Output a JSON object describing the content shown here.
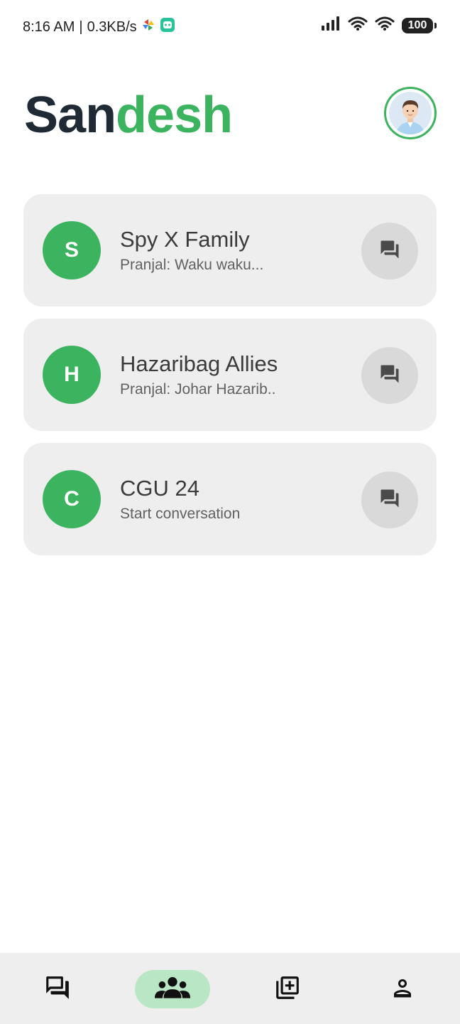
{
  "status_bar": {
    "time": "8:16 AM",
    "separator": "|",
    "speed": "0.3KB/s",
    "battery": "100",
    "icons": [
      "pinwheel-icon",
      "robot-app-icon",
      "signal-icon",
      "wifi-icon",
      "wifi-icon",
      "battery-icon"
    ]
  },
  "header": {
    "title_part_1": "San",
    "title_part_2": "desh",
    "accent_color": "#3cb35f",
    "title_dark_color": "#1f2a35"
  },
  "chats": [
    {
      "initial": "S",
      "name": "Spy X Family",
      "preview": "Pranjal: Waku waku..."
    },
    {
      "initial": "H",
      "name": "Hazaribag Allies",
      "preview": "Pranjal: Johar Hazarib.."
    },
    {
      "initial": "C",
      "name": "CGU 24",
      "preview": "Start conversation"
    }
  ],
  "bottom_nav": {
    "items": [
      "chats-icon",
      "groups-icon",
      "add-icon",
      "profile-icon"
    ],
    "active": "groups-icon",
    "active_color": "#b9e7c5"
  }
}
